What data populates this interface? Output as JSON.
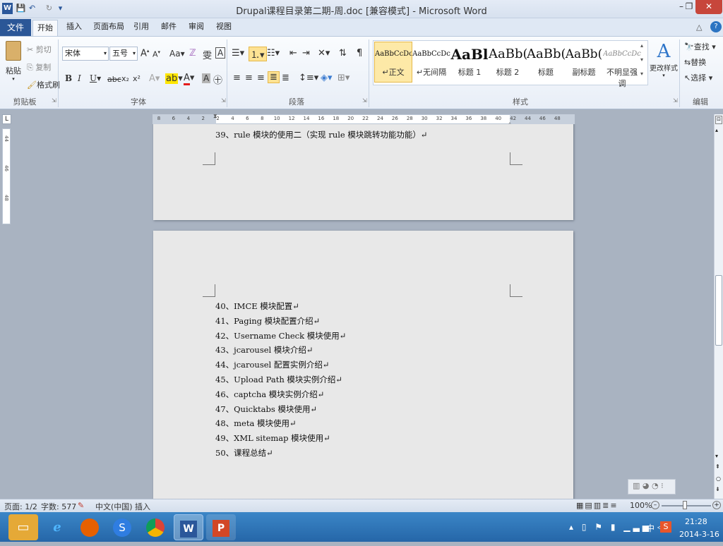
{
  "titlebar": {
    "title": "Drupal课程目录第二期-周.doc [兼容模式] - Microsoft Word",
    "word_icon": "W",
    "save_icon": "save-icon",
    "undo_icon": "undo-icon",
    "redo_icon": "redo-icon",
    "minimize": "–",
    "restore": "❐",
    "close": "✕"
  },
  "tabs": {
    "file": "文件",
    "home": "开始",
    "insert": "插入",
    "layout": "页面布局",
    "references": "引用",
    "mailings": "邮件",
    "review": "审阅",
    "view": "视图"
  },
  "ribbon": {
    "clipboard": {
      "paste": "粘贴",
      "cut": "剪切",
      "copy": "复制",
      "format_painter": "格式刷",
      "label": "剪贴板"
    },
    "font": {
      "name": "宋体",
      "size": "五号",
      "label": "字体",
      "bold": "B",
      "italic": "I",
      "underline": "U",
      "strike": "abc",
      "sub": "x₂",
      "sup": "x²"
    },
    "paragraph": {
      "label": "段落"
    },
    "styles": {
      "label": "样式",
      "items": [
        {
          "preview": "AaBbCcDc",
          "name": "↵正文"
        },
        {
          "preview": "AaBbCcDc",
          "name": "↵无间隔"
        },
        {
          "preview": "AaBl",
          "name": "标题 1"
        },
        {
          "preview": "AaBb(",
          "name": "标题 2"
        },
        {
          "preview": "AaBb(",
          "name": "标题"
        },
        {
          "preview": "AaBb(",
          "name": "副标题"
        },
        {
          "preview": "AaBbCcDc",
          "name": "不明显强调"
        }
      ],
      "change": "更改样式"
    },
    "editing": {
      "label": "编辑",
      "find": "查找",
      "replace": "替换",
      "select": "选择"
    }
  },
  "ruler": {
    "ticks": [
      "8",
      "6",
      "4",
      "2",
      "2",
      "4",
      "6",
      "8",
      "10",
      "12",
      "14",
      "16",
      "18",
      "20",
      "22",
      "24",
      "26",
      "28",
      "30",
      "32",
      "34",
      "36",
      "38",
      "40",
      "42",
      "44",
      "46",
      "48"
    ]
  },
  "vruler": {
    "ticks": [
      "44",
      "46",
      "48"
    ]
  },
  "document": {
    "page1_lines": [
      "39、rule 模块的使用二（实现 rule 模块跳转功能功能）↵"
    ],
    "page2_lines": [
      "40、IMCE 模块配置↵",
      "41、Paging 模块配置介绍↵",
      "42、Username Check 模块使用↵",
      "43、jcarousel  模块介绍↵",
      "44、jcarousel 配置实例介绍↵",
      "45、Upload Path  模块实例介绍↵",
      "46、captcha 模块实例介绍↵",
      "47、Quicktabs 模块使用↵",
      "48、meta 模块使用↵",
      "49、XML sitemap 模块使用↵",
      "50、课程总结↵"
    ]
  },
  "statusbar": {
    "page": "页面: 1/2",
    "words": "字数: 577",
    "lang": "中文(中国)",
    "mode": "插入",
    "zoom": "100%"
  },
  "taskbar": {
    "time": "21:28",
    "date": "2014-3-16",
    "ime": "中"
  }
}
